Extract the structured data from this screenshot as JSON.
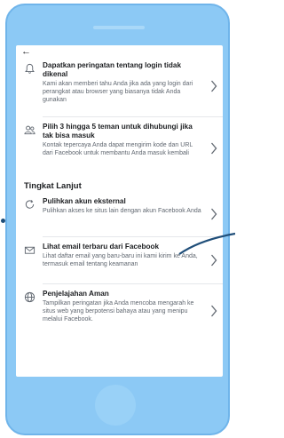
{
  "header": {
    "back_icon": "arrow-left-icon"
  },
  "items_top": [
    {
      "icon": "bell-icon",
      "title": "Dapatkan peringatan tentang login tidak dikenal",
      "desc": "Kami akan memberi tahu Anda jika ada yang login dari perangkat atau browser yang biasanya tidak Anda gunakan"
    },
    {
      "icon": "friends-icon",
      "title": "Pilih 3 hingga 5 teman untuk dihubungi jika tak bisa masuk",
      "desc": "Kontak tepercaya Anda dapat mengirim kode dan URL dari Facebook untuk membantu Anda masuk kembali"
    }
  ],
  "section": {
    "title": "Tingkat Lanjut"
  },
  "items_adv": [
    {
      "icon": "refresh-icon",
      "title": "Pulihkan akun eksternal",
      "desc": "Pulihkan akses ke situs lain dengan akun Facebook Anda"
    },
    {
      "icon": "email-icon",
      "title": "Lihat email terbaru dari Facebook",
      "desc": "Lihat daftar email yang baru-baru ini kami kirim ke Anda, termasuk email tentang keamanan"
    },
    {
      "icon": "globe-icon",
      "title": "Penjelajahan Aman",
      "desc": "Tampilkan peringatan jika Anda mencoba mengarah ke situs web yang berpotensi bahaya atau yang menipu melalui Facebook."
    }
  ],
  "colors": {
    "frame": "#8cc9f5",
    "accent_line": "#1f4e79"
  }
}
